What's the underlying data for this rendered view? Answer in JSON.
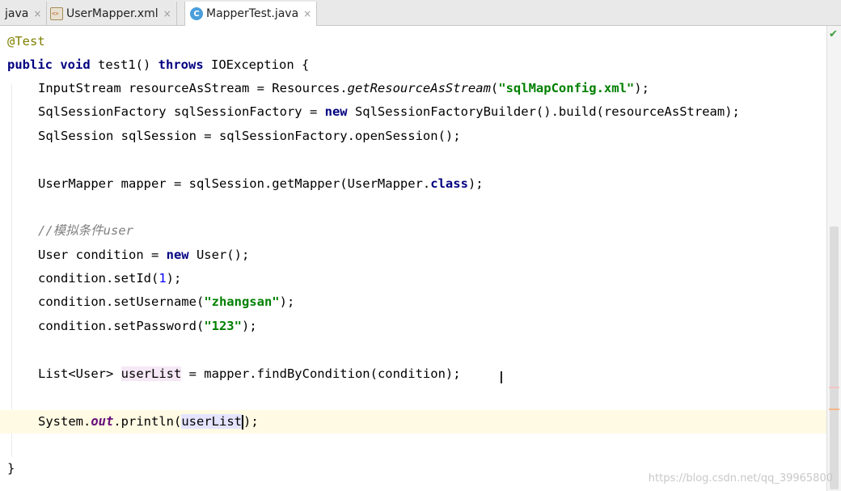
{
  "tabs": [
    {
      "label": "java",
      "icon": "java-file-icon",
      "active": false
    },
    {
      "label": "UserMapper.xml",
      "icon": "xml-file-icon",
      "active": false
    },
    {
      "label": "MapperTest.java",
      "icon": "java-class-icon",
      "active": true
    }
  ],
  "tab_close_glyph": "×",
  "class_icon_letter": "C",
  "code": {
    "annotation": "@Test",
    "l2": {
      "kw_public": "public",
      "kw_void": "void",
      "name": " test1() ",
      "kw_throws": "throws",
      "rest": " IOException {"
    },
    "l3": {
      "a": "InputStream resourceAsStream = Resources.",
      "m": "getResourceAsStream",
      "b": "(",
      "s": "\"sqlMapConfig.xml\"",
      "c": ");"
    },
    "l4": {
      "a": "SqlSessionFactory sqlSessionFactory = ",
      "kw": "new",
      "b": " SqlSessionFactoryBuilder().build(resourceAsStream);"
    },
    "l5": {
      "a": "SqlSession sqlSession = sqlSessionFactory.openSession();"
    },
    "l7": {
      "a": "UserMapper mapper = sqlSession.getMapper(UserMapper.",
      "kw": "class",
      "b": ");"
    },
    "l9": {
      "comment": "//模拟条件user"
    },
    "l10": {
      "a": "User condition = ",
      "kw": "new",
      "b": " User();"
    },
    "l11": {
      "a": "condition.setId(",
      "n": "1",
      "b": ");"
    },
    "l12": {
      "a": "condition.setUsername(",
      "s": "\"zhangsan\"",
      "b": ");"
    },
    "l13": {
      "a": "condition.setPassword(",
      "s": "\"123\"",
      "b": ");"
    },
    "l15": {
      "a": "List<User> ",
      "v": "userList",
      "b": " = mapper.findByCondition(condition);"
    },
    "l17": {
      "a": "System.",
      "f": "out",
      "b": ".println(",
      "r": "userList",
      "c": ");"
    },
    "l19": {
      "a": "}"
    }
  },
  "watermark": "https://blog.csdn.net/qq_39965800",
  "colors": {
    "keyword": "#000080",
    "string": "#008000",
    "number": "#0000ff",
    "annotation": "#808000",
    "field": "#660e7a",
    "comment": "#808080",
    "caret_line": "#fffae3"
  }
}
